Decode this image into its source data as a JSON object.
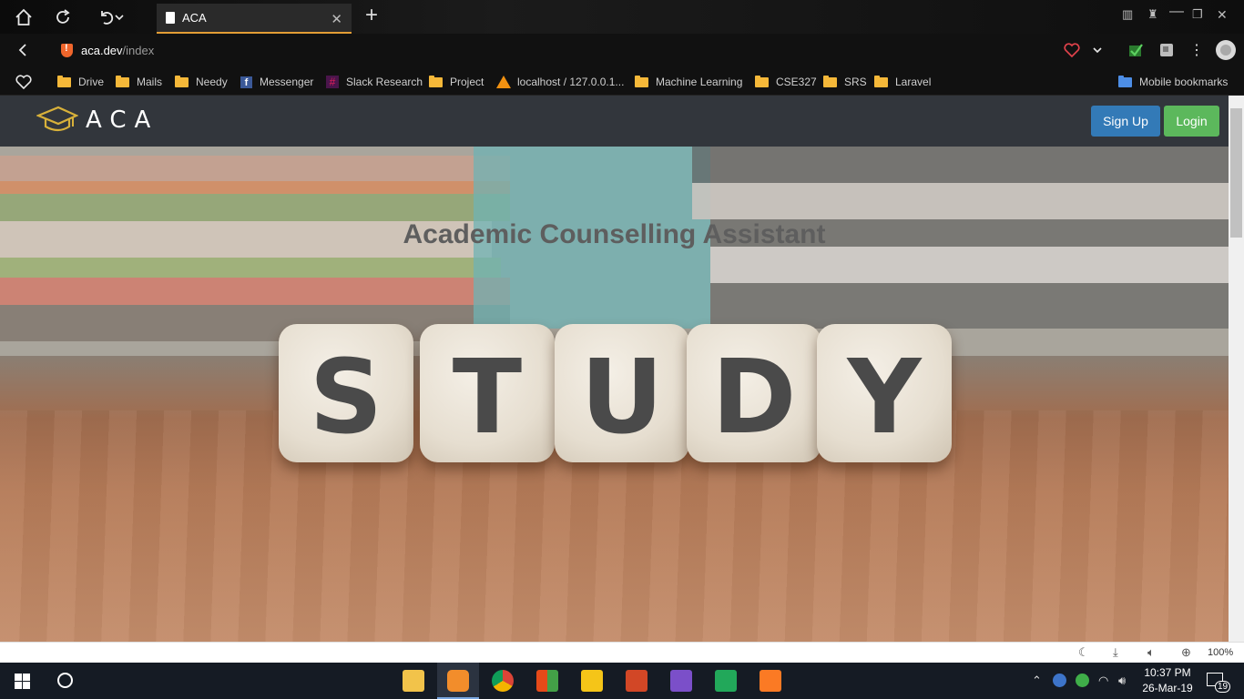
{
  "browser": {
    "tab": {
      "title": "ACA"
    },
    "url": {
      "host": "aca.dev",
      "path": "/index"
    },
    "bookmarks": [
      {
        "label": "Drive",
        "icon": "folder-icon"
      },
      {
        "label": "Mails",
        "icon": "folder-icon"
      },
      {
        "label": "Needy",
        "icon": "folder-icon"
      },
      {
        "label": "Messenger",
        "icon": "facebook-icon"
      },
      {
        "label": "Slack Research",
        "icon": "slack-icon"
      },
      {
        "label": "Project",
        "icon": "folder-icon"
      },
      {
        "label": "localhost / 127.0.0.1...",
        "icon": "phpmyadmin-icon"
      },
      {
        "label": "Machine Learning",
        "icon": "folder-icon"
      },
      {
        "label": "CSE327",
        "icon": "folder-icon"
      },
      {
        "label": "SRS",
        "icon": "folder-icon"
      },
      {
        "label": "Laravel",
        "icon": "folder-icon"
      }
    ],
    "mobile_bookmarks": "Mobile bookmarks",
    "zoom": "100%"
  },
  "page": {
    "logo_text": "ACA",
    "signup_label": "Sign Up",
    "login_label": "Login",
    "hero_title": "Academic Counselling Assistant",
    "dice_letters": [
      "S",
      "T",
      "U",
      "D",
      "Y"
    ]
  },
  "taskbar": {
    "time": "10:37 PM",
    "date": "26-Mar-19",
    "notifications": "19"
  },
  "colors": {
    "signup": "#337ab7",
    "login": "#5cb85c",
    "navbar": "#32363c",
    "tab_accent": "#e39d35"
  }
}
